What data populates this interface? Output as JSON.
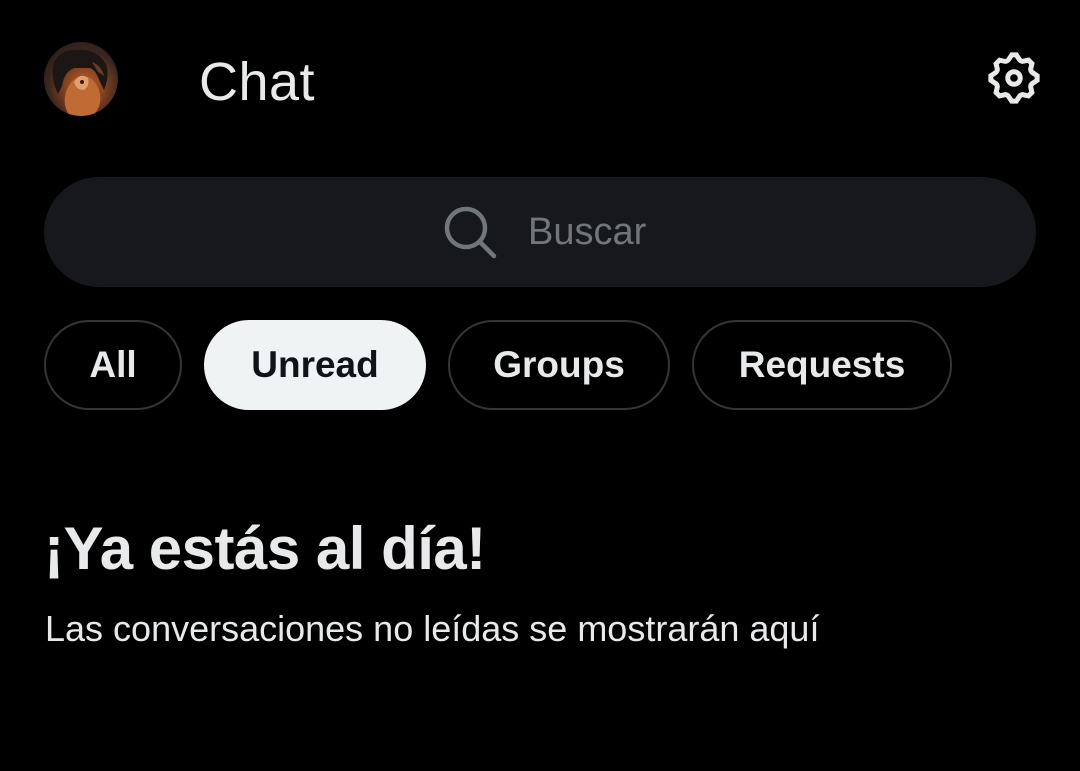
{
  "header": {
    "title": "Chat",
    "avatar_icon": "user-avatar",
    "settings_icon": "gear-icon"
  },
  "search": {
    "placeholder": "Buscar",
    "icon": "search-icon"
  },
  "filters": {
    "active": "Unread",
    "items": [
      {
        "label": "All"
      },
      {
        "label": "Unread"
      },
      {
        "label": "Groups"
      },
      {
        "label": "Requests"
      }
    ]
  },
  "empty_state": {
    "title": "¡Ya estás al día!",
    "subtitle": "Las conversaciones no leídas se mostrarán aquí"
  },
  "colors": {
    "background": "#000000",
    "text": "#e7e9ea",
    "muted": "#71767b",
    "search_bg": "#16181c",
    "chip_border": "#333639",
    "chip_active_bg": "#eff3f4"
  }
}
